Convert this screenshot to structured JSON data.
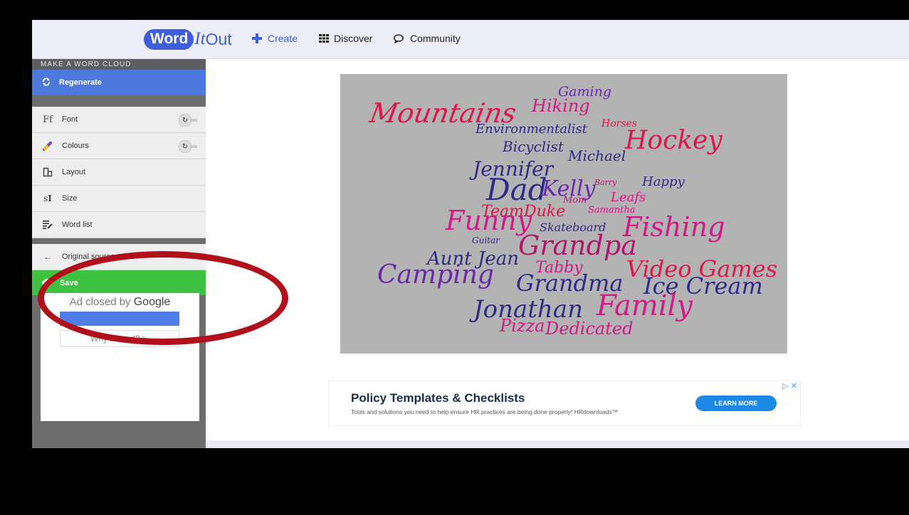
{
  "header": {
    "logo_word": "Word",
    "logo_it": "It",
    "logo_out": "Out",
    "create": "Create",
    "discover": "Discover",
    "community": "Community"
  },
  "sidebar": {
    "heading": "MAKE A WORD CLOUD",
    "regenerate": "Regenerate",
    "items": [
      {
        "label": "Font",
        "icon": "font-icon",
        "glyph": "Ff"
      },
      {
        "label": "Colours",
        "icon": "palette-icon",
        "glyph": "✎"
      },
      {
        "label": "Layout",
        "icon": "layout-icon",
        "glyph": "⧉"
      },
      {
        "label": "Size",
        "icon": "size-icon",
        "glyph": "s↕"
      },
      {
        "label": "Word list",
        "icon": "list-edit-icon",
        "glyph": "☰"
      }
    ],
    "original_source": "Original source",
    "save": "Save",
    "ad_closed": "Ad closed by",
    "ad_google": "Google",
    "why_ad": "Why this ad? ▷"
  },
  "cloud": {
    "words": [
      "Mountains",
      "Hiking",
      "Gaming",
      "Horses",
      "Environmentalist",
      "Hockey",
      "Bicyclist",
      "Michael",
      "Jennifer",
      "Dad",
      "Kelly",
      "Barry",
      "Happy",
      "Mom",
      "Leafs",
      "TeamDuke",
      "Samantha",
      "Funny",
      "Skateboard",
      "Fishing",
      "Guitar",
      "Grandpa",
      "Aunt Jean",
      "Tabby",
      "Video Games",
      "Camping",
      "Grandma",
      "Ice Cream",
      "Jonathan",
      "Family",
      "Pizza",
      "Dedicated"
    ]
  },
  "ad_banner": {
    "title": "Policy Templates & Checklists",
    "subtitle": "Tools and solutions you need to help ensure HR practices are being done properly! HRdownloads™",
    "button": "LEARN MORE",
    "close": "▷ ✕"
  },
  "colors": {
    "brand": "#3d5fd9",
    "regenerate": "#4e79dc",
    "save": "#3fc241",
    "annotation": "#b0101b"
  }
}
